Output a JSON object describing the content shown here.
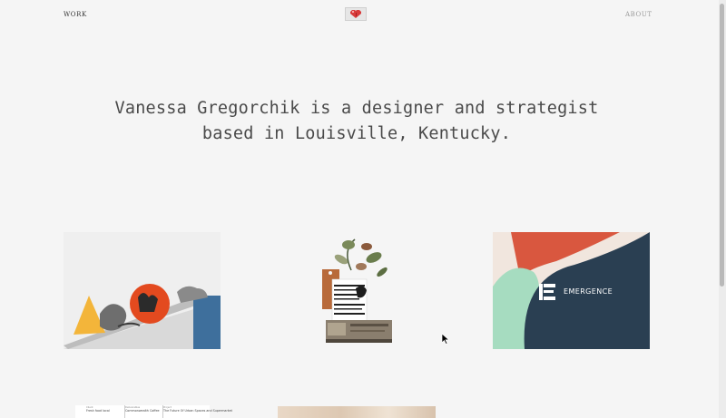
{
  "nav": {
    "work_label": "WORK",
    "about_label": "ABOUT"
  },
  "logo": {
    "icon": "pixel-heart-icon"
  },
  "hero": {
    "line1": "Vanessa Gregorchik is a designer and strategist",
    "line2": "based in Louisville, Kentucky."
  },
  "projects": [
    {
      "icon": "collage-image-shapes"
    },
    {
      "icon": "collage-image-plant"
    },
    {
      "icon": "emergence-brand-image",
      "brand_text": "EMERGENCE"
    }
  ],
  "card4": {
    "cols": [
      {
        "k": "Client",
        "v": "Fresh food local"
      },
      {
        "k": "Deliverables",
        "v": "Commonwealth Coffee"
      },
      {
        "k": "Project",
        "v": "The Future Of Urban Spaces and Supermarket"
      }
    ]
  },
  "colors": {
    "background": "#f5f5f5",
    "headline": "#4a4a4a",
    "emergence_navy": "#2a3f52",
    "emergence_red": "#d9573f",
    "emergence_mint": "#a6dcc0"
  }
}
